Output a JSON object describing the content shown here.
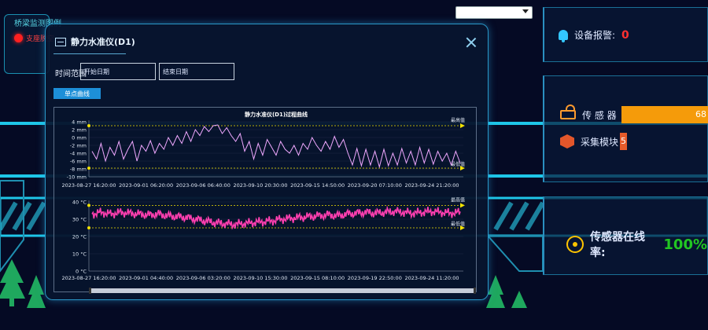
{
  "top_select": {
    "value": ""
  },
  "nav": {
    "title": "桥梁监测图例",
    "item": "支座脱空"
  },
  "alarm": {
    "label": "设备报警:",
    "count": "0"
  },
  "sensors": {
    "sensor_label": "传 感 器",
    "sensor_count": "68",
    "sensor_fraction": 1.0,
    "module_label": "采集模块",
    "module_count": "5",
    "module_fraction": 0.07
  },
  "online": {
    "label": "传感器在线率:",
    "value": "100%"
  },
  "modal": {
    "title": "静力水准仪(D1)",
    "time_label": "时间范围",
    "start_placeholder": "开始日期",
    "end_placeholder": "结束日期",
    "curve_button": "单点曲线"
  },
  "colors": {
    "line1": "#f0a8ff",
    "line2": "#ff3fb0",
    "threshold": "#f2e200",
    "bar_orange": "#f59b0a"
  },
  "chart_data": [
    {
      "type": "line",
      "title": "静力水准仪(D1)过程曲线",
      "y_ticks": [
        "4 mm",
        "2 mm",
        "0 mm",
        "-2 mm",
        "-4 mm",
        "-6 mm",
        "-8 mm",
        "-10 mm"
      ],
      "ylim": [
        -10,
        4
      ],
      "x_ticks": [
        "2023-08-27 16:20:00",
        "2023-09-01 06:20:00",
        "2023-09-06 06:40:00",
        "2023-09-10 20:30:00",
        "2023-09-15 14:50:00",
        "2023-09-20 07:10:00",
        "2023-09-24 21:20:00"
      ],
      "upper_threshold": {
        "label": "最高值",
        "value": 3
      },
      "lower_threshold": {
        "label": "最低值",
        "value": -7.8
      },
      "series": [
        {
          "values": [
            -3.5,
            -5.5,
            -1.5,
            -6,
            -2.5,
            -4.5,
            -1,
            -5.5,
            -3,
            -1,
            -6,
            -2,
            -3.5,
            -0.8,
            -4,
            -1.5,
            -3,
            0,
            -2,
            0.5,
            -1.5,
            1.5,
            -1,
            2,
            0.5,
            2.8,
            1.5,
            3,
            3.2,
            1,
            2.5,
            0.5,
            -1,
            1,
            -3.5,
            -1,
            -5.5,
            -1.5,
            -4.5,
            -0.5,
            -2.5,
            -4.5,
            -1,
            -3,
            -4,
            -2,
            -4.5,
            -1.5,
            -3,
            0,
            -2,
            -3.5,
            -1,
            -3,
            0.3,
            -2.5,
            -0.5,
            -4,
            -7,
            -2.8,
            -7.2,
            -3,
            -7,
            -3.5,
            -7.5,
            -3,
            -7.2,
            -4,
            -7,
            -2.8,
            -6.5,
            -3.5,
            -7,
            -2.5,
            -6.5,
            -3,
            -6.8,
            -3.5,
            -6,
            -4,
            -7,
            -3.5,
            -6.5
          ]
        }
      ]
    },
    {
      "type": "line",
      "y_ticks": [
        "40 °C",
        "30 °C",
        "20 °C",
        "10 °C",
        "0 °C"
      ],
      "ylim": [
        0,
        40
      ],
      "x_ticks": [
        "2023-08-27 16:20:00",
        "2023-09-01 04:40:00",
        "2023-09-06 03:20:00",
        "2023-09-10 15:30:00",
        "2023-09-15 08:10:00",
        "2023-09-19 22:50:00",
        "2023-09-24 11:20:00"
      ],
      "upper_threshold": {
        "label": "最高值",
        "value": 38
      },
      "lower_threshold": {
        "label": "最低值",
        "value": 25
      },
      "series": [
        {
          "values": [
            33,
            34,
            33,
            34,
            33.5,
            33,
            32.5,
            33,
            32,
            31.5,
            31,
            30,
            29,
            28,
            27.5,
            27,
            27.5,
            28,
            28.5,
            29,
            30,
            30.5,
            31,
            31.5,
            32,
            32.5,
            32,
            33,
            33.5,
            34,
            33.5,
            34,
            34.5,
            34,
            33.5,
            34,
            34.5,
            34,
            33.5,
            34
          ]
        }
      ]
    }
  ]
}
